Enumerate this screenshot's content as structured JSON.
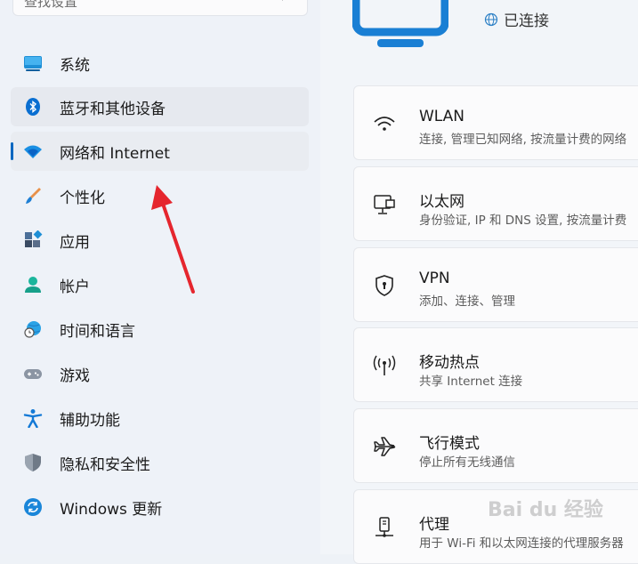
{
  "search": {
    "placeholder": "查找设置"
  },
  "nav": [
    {
      "label": "系统",
      "icon": "monitor-icon"
    },
    {
      "label": "蓝牙和其他设备",
      "icon": "bluetooth-icon"
    },
    {
      "label": "网络和 Internet",
      "icon": "wifi-icon",
      "selected": true
    },
    {
      "label": "个性化",
      "icon": "brush-icon"
    },
    {
      "label": "应用",
      "icon": "apps-icon"
    },
    {
      "label": "帐户",
      "icon": "person-icon"
    },
    {
      "label": "时间和语言",
      "icon": "globe-clock-icon"
    },
    {
      "label": "游戏",
      "icon": "gamepad-icon"
    },
    {
      "label": "辅助功能",
      "icon": "accessibility-icon"
    },
    {
      "label": "隐私和安全性",
      "icon": "shield-icon"
    },
    {
      "label": "Windows 更新",
      "icon": "update-icon"
    }
  ],
  "header": {
    "status": "已连接"
  },
  "cards": [
    {
      "title": "WLAN",
      "desc": "连接, 管理已知网络, 按流量计费的网络",
      "icon": "wifi-icon"
    },
    {
      "title": "以太网",
      "desc": "身份验证, IP 和 DNS 设置, 按流量计费",
      "icon": "ethernet-icon"
    },
    {
      "title": "VPN",
      "desc": "添加、连接、管理",
      "icon": "vpn-shield-icon"
    },
    {
      "title": "移动热点",
      "desc": "共享 Internet 连接",
      "icon": "hotspot-icon"
    },
    {
      "title": "飞行模式",
      "desc": "停止所有无线通信",
      "icon": "airplane-icon"
    },
    {
      "title": "代理",
      "desc": "用于 Wi-Fi 和以太网连接的代理服务器",
      "icon": "proxy-icon"
    }
  ],
  "watermark": "Bai du 经验",
  "colors": {
    "accent": "#0067c0",
    "arrow": "#e5262e"
  }
}
